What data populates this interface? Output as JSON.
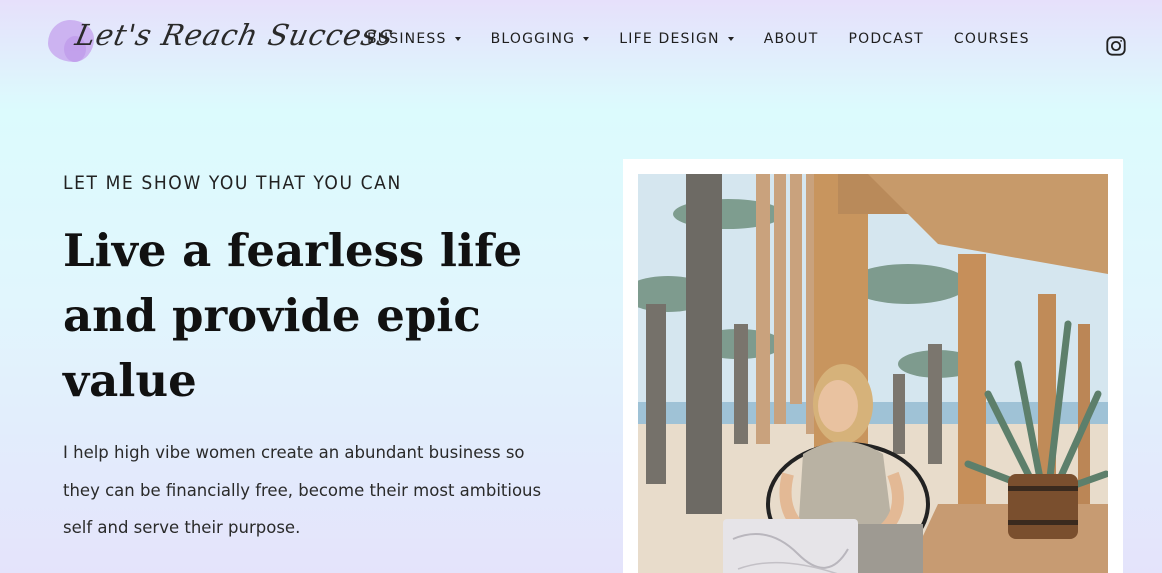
{
  "brand": {
    "logo_text": "Let's Reach Success"
  },
  "nav": {
    "items": [
      {
        "label": "BUSINESS",
        "dropdown": true
      },
      {
        "label": "BLOGGING",
        "dropdown": true
      },
      {
        "label": "LIFE DESIGN",
        "dropdown": true
      },
      {
        "label": "ABOUT",
        "dropdown": false
      },
      {
        "label": "PODCAST",
        "dropdown": false
      },
      {
        "label": "COURSES",
        "dropdown": false
      }
    ],
    "social_icon": "instagram-icon"
  },
  "hero": {
    "eyebrow": "LET ME SHOW YOU THAT YOU CAN",
    "headline": "Live a fearless life and provide epic value",
    "body": "I help high vibe women create an abundant business so they can be financially free, become their most ambitious self and serve their purpose."
  },
  "colors": {
    "accent_blob": "#c8a9ee",
    "background_top": "#e6e0fb",
    "background_mid": "#dcfbfd",
    "text": "#111111"
  }
}
